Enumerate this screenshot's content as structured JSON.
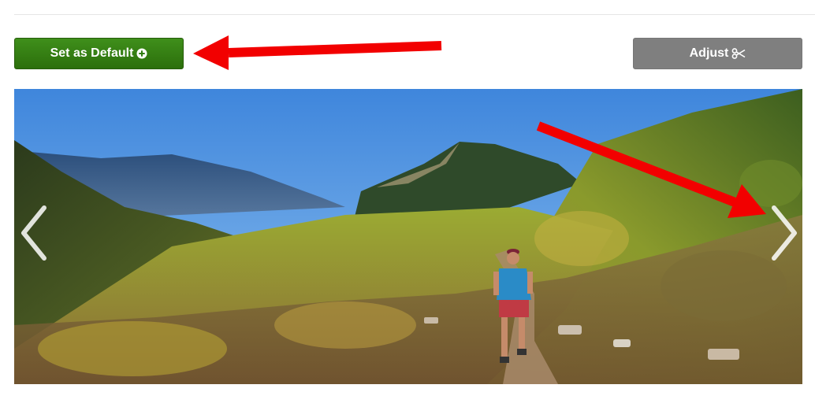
{
  "toolbar": {
    "set_default_label": "Set as Default",
    "set_default_icon": "plus-circle-icon",
    "adjust_label": "Adjust",
    "adjust_icon": "scissors-icon"
  },
  "carousel": {
    "image_subject": "trail-runner-mountain-valley-photo",
    "prev_icon": "chevron-left-icon",
    "next_icon": "chevron-right-icon"
  },
  "annotations": {
    "arrow_color": "#f20000",
    "arrows": [
      "arrow-to-set-default",
      "arrow-to-next-slide"
    ]
  },
  "colors": {
    "primary_green": "#2f7c0f",
    "adjust_gray": "#7f7f7f"
  }
}
